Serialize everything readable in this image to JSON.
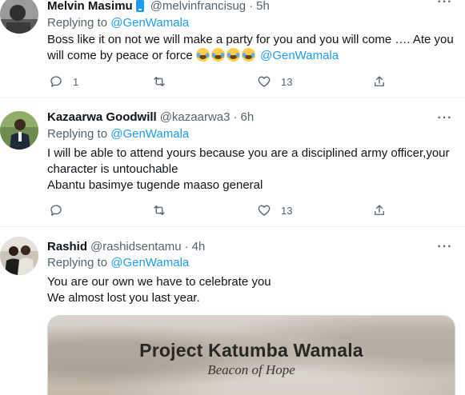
{
  "tweets": [
    {
      "name": "Melvin Masimu",
      "handle": "@melvinfrancisug",
      "dot": "·",
      "time": "5h",
      "replying_prefix": "Replying to ",
      "replying_to": "@GenWamala",
      "text_line1": "Boss like it on not we will make a party for you and you will come …. Ate you",
      "text_line2": "will come by peace or force ",
      "text_mention": "@GenWamala",
      "emoji_count": 4,
      "reply_count": "1",
      "retweet_count": "",
      "like_count": "13"
    },
    {
      "name": "Kazaarwa Goodwill",
      "handle": "@kazaarwa3",
      "dot": "·",
      "time": "6h",
      "replying_prefix": "Replying to ",
      "replying_to": "@GenWamala",
      "text_line1": "I will be able to attend yours because you are a disciplined army officer,your",
      "text_line2": "character is untouchable",
      "text_line3": "Abantu basimye tugende maaso general",
      "reply_count": "",
      "retweet_count": "",
      "like_count": "13"
    },
    {
      "name": "Rashid",
      "handle": "@rashidsentamu",
      "dot": "·",
      "time": "4h",
      "replying_prefix": "Replying to ",
      "replying_to": "@GenWamala",
      "text_line1": "You are our own we have to celebrate you",
      "text_line2": "We almost lost you last year.",
      "media_title": "Project Katumba Wamala",
      "media_subtitle": "Beacon of Hope"
    }
  ],
  "icons": {
    "more": "more-horizontal-icon",
    "reply": "reply-icon",
    "retweet": "retweet-icon",
    "like": "heart-icon",
    "share": "share-icon",
    "emoji": "face-with-tears-of-joy-icon",
    "badge": "phone-badge-icon"
  },
  "colors": {
    "link": "#1d9bf0",
    "secondary_text": "#536471",
    "divider": "#eff3f4"
  }
}
